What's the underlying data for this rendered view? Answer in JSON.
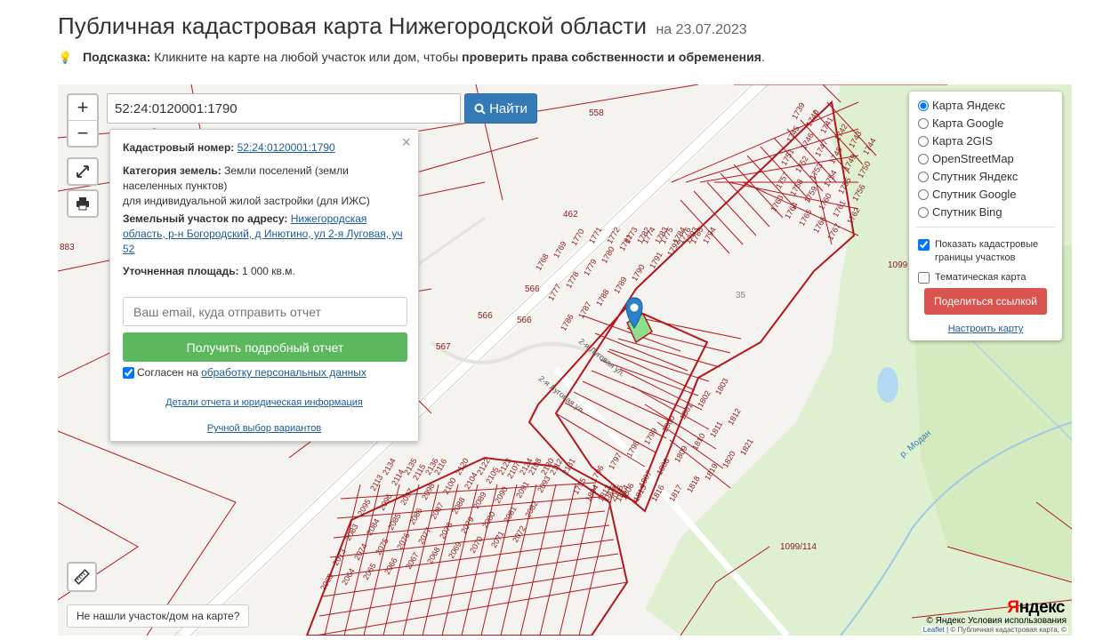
{
  "header": {
    "title": "Публичная кадастровая карта Нижегородской области",
    "date": "на 23.07.2023"
  },
  "hint": {
    "label": "Подсказка:",
    "text": "Кликните на карте на любой участок или дом, чтобы",
    "bold_text": "проверить права собственности и обременения",
    "end": "."
  },
  "search": {
    "value": "52:24:0120001:1790",
    "button_label": "Найти"
  },
  "zoom": {
    "in": "+",
    "out": "−"
  },
  "popup": {
    "cadastral_label": "Кадастровый номер:",
    "cadastral_value": "52:24:0120001:1790",
    "category_label": "Категория земель:",
    "category_value": "Земли поселений (земли населенных пунктов)",
    "category_use": "для индивидуальной жилой застройки (для ИЖС)",
    "address_label": "Земельный участок по адресу:",
    "address_value": "Нижегородская область, р-н Богородский, д Инютино, ул 2-я Луговая, уч 52",
    "area_label": "Уточненная площадь:",
    "area_value": "1 000 кв.м.",
    "email_placeholder": "Ваш email, куда отправить отчет",
    "report_button": "Получить подробный отчет",
    "agree_text": "Согласен на",
    "agree_link": "обработку персональных данных",
    "details_link": "Детали отчета и юридическая информация",
    "manual_link": "Ручной выбор вариантов"
  },
  "layers": {
    "options": [
      {
        "label": "Карта Яндекс",
        "checked": true
      },
      {
        "label": "Карта Google",
        "checked": false
      },
      {
        "label": "Карта 2GIS",
        "checked": false
      },
      {
        "label": "OpenStreetMap",
        "checked": false
      },
      {
        "label": "Спутник Яндекс",
        "checked": false
      },
      {
        "label": "Спутник Google",
        "checked": false
      },
      {
        "label": "Спутник Bing",
        "checked": false
      }
    ],
    "show_borders": "Показать кадастровые границы участков",
    "thematic": "Тематическая карта",
    "share": "Поделиться ссылкой",
    "configure": "Настроить карту"
  },
  "map_labels": {
    "parcels_far": [
      "558",
      "462",
      "883",
      "566",
      "566",
      "566",
      "567",
      "1099",
      "1099/114",
      "35"
    ],
    "river": "р. Модан",
    "street": "2-я Луговая ул.",
    "parcels_east": [
      "1739",
      "1740",
      "1741",
      "1742",
      "1743",
      "1744",
      "1745",
      "1746",
      "1747",
      "1748",
      "1749",
      "1750",
      "1751",
      "1752",
      "1753",
      "1754",
      "1755",
      "1756",
      "1757",
      "1758",
      "1759",
      "1760",
      "1761",
      "1762",
      "1763",
      "1764",
      "1765",
      "1766",
      "1767"
    ],
    "parcels_mid": [
      "1768",
      "1769",
      "1770",
      "1771",
      "1772",
      "1773",
      "1774",
      "1775",
      "1776",
      "1777",
      "1778",
      "1779",
      "1780",
      "1781",
      "1782",
      "1783",
      "1784",
      "1785",
      "1786",
      "1787",
      "1788",
      "1789",
      "1790",
      "1791",
      "1792",
      "1793",
      "1794",
      "1795",
      "1796",
      "1797",
      "1798",
      "1799",
      "1800",
      "1801",
      "1802",
      "1803",
      "1804",
      "1805",
      "1806",
      "1807",
      "1808",
      "1809",
      "1810",
      "1811",
      "1812",
      "1813",
      "1814",
      "1815",
      "1816",
      "1817",
      "1818",
      "1819",
      "1820",
      "1821",
      "2056"
    ],
    "parcels_south": [
      "2063",
      "2064",
      "2065",
      "2066",
      "2067",
      "2068",
      "2069",
      "2070",
      "2071",
      "2072",
      "2073",
      "2074",
      "2075",
      "2076",
      "2077",
      "2078",
      "2079",
      "2080",
      "2081",
      "2082",
      "2083",
      "2084",
      "2085",
      "2086",
      "2087",
      "2088",
      "2089",
      "2090",
      "2091",
      "2093",
      "2095",
      "2096",
      "2097",
      "2098",
      "2100",
      "2104",
      "2105",
      "2107",
      "2108",
      "2112",
      "2113",
      "2114",
      "2115",
      "2116",
      "2120",
      "2122",
      "2123",
      "2124",
      "2130",
      "2131",
      "2134",
      "2135",
      "2136"
    ]
  },
  "controls": {
    "not_found": "Не нашли участок/дом на карте?"
  },
  "attribution": {
    "yandex_y": "Я",
    "yandex_rest": "ндекс",
    "copyright": "© Яндекс  Условия использования",
    "leaflet": "Leaflet",
    "sources": "| © Публичная кадастровая карта, ©"
  },
  "colors": {
    "parcel_border": "#b5161c",
    "selected_parcel": "#8ce08c",
    "green_area": "#dff0d0",
    "water": "#b3d9f2",
    "primary": "#337ab7",
    "success": "#5cb85c",
    "danger": "#d9534f"
  }
}
